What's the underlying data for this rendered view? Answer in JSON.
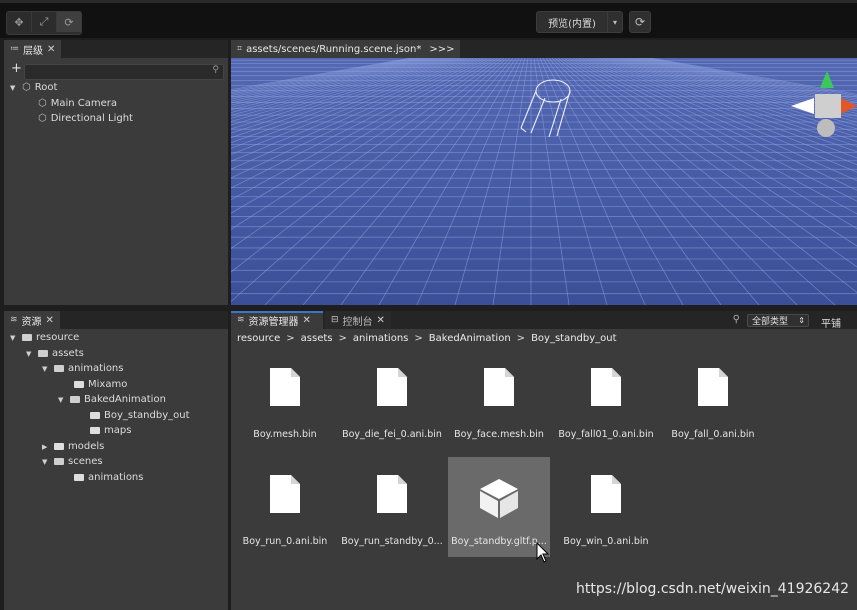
{
  "toolbar": {
    "tools": [
      {
        "name": "move-tool",
        "icon": "move-icon",
        "glyph": "✥"
      },
      {
        "name": "scale-tool",
        "icon": "scale-icon",
        "glyph": "⤢"
      },
      {
        "name": "rotate-tool",
        "icon": "rotate-icon",
        "glyph": "⟳"
      }
    ],
    "preview_label": "预览(内置)",
    "preview_arrow": "▾",
    "refresh_glyph": "⟳"
  },
  "hierarchy": {
    "tab_label": "层级",
    "tab_icon": "≔",
    "close": "✕",
    "plus": "+",
    "search_icon": "⚲",
    "nodes": [
      {
        "label": "Root"
      },
      {
        "label": "Main Camera"
      },
      {
        "label": "Directional Light"
      }
    ]
  },
  "scene": {
    "tab_icon": "⌗",
    "tab_label": "assets/scenes/Running.scene.json*",
    "more": ">>>",
    "colors": {
      "ground": "#4257a0",
      "grid": "#8fa3e0"
    }
  },
  "resources": {
    "tab_icon": "≋",
    "tab_label": "资源",
    "close": "✕",
    "tree": [
      {
        "label": "resource"
      },
      {
        "label": "assets"
      },
      {
        "label": "animations"
      },
      {
        "label": "Mixamo"
      },
      {
        "label": "BakedAnimation"
      },
      {
        "label": "Boy_standby_out"
      },
      {
        "label": "maps"
      },
      {
        "label": "models"
      },
      {
        "label": "scenes"
      },
      {
        "label": "animations"
      }
    ]
  },
  "asset_browser": {
    "tab_label": "资源管理器",
    "tab_icon": "≋",
    "console_label": "控制台",
    "console_icon": "⊟",
    "close": "✕",
    "search_icon": "⚲",
    "filter_label": "全部类型",
    "filter_chev": "⇕",
    "view_label": "平铺",
    "breadcrumb": [
      "resource",
      "assets",
      "animations",
      "BakedAnimation",
      "Boy_standby_out"
    ],
    "breadcrumb_sep": ">",
    "files": [
      {
        "name": "Boy.mesh.bin",
        "type": "file"
      },
      {
        "name": "Boy_die_fei_0.ani.bin",
        "type": "file"
      },
      {
        "name": "Boy_face.mesh.bin",
        "type": "file"
      },
      {
        "name": "Boy_fall01_0.ani.bin",
        "type": "file"
      },
      {
        "name": "Boy_fall_0.ani.bin",
        "type": "file"
      },
      {
        "name": "Boy_run_0.ani.bin",
        "type": "file"
      },
      {
        "name": "Boy_run_standby_0...",
        "type": "file"
      },
      {
        "name": "Boy_standby.gltf.p...",
        "type": "model",
        "selected": true
      },
      {
        "name": "Boy_win_0.ani.bin",
        "type": "file"
      }
    ]
  },
  "watermark": "https://blog.csdn.net/weixin_41926242"
}
